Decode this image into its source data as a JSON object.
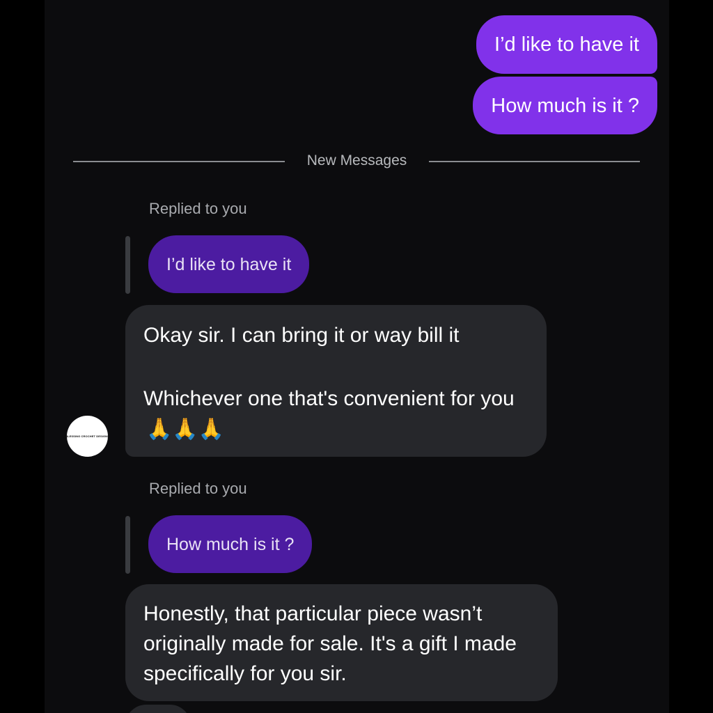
{
  "conversation": {
    "outgoing": [
      {
        "text": "I’d like to have it"
      },
      {
        "text": "How much is it ?"
      }
    ],
    "divider_label": "New Messages",
    "replies": [
      {
        "replied_label": "Replied to you",
        "quoted_text": "I’d like to have it",
        "reply_paragraph_1": "Okay sir. I can bring it or way bill it",
        "reply_paragraph_2": "Whichever one that's convenient for you",
        "reply_emoji": "🙏🙏🙏"
      },
      {
        "replied_label": "Replied to you",
        "quoted_text": "How much is it ?",
        "reply_text": "Honestly, that particular piece wasn’t originally made for sale. It's a gift I made specifically for you sir."
      }
    ],
    "sender_avatar_text": "BLESSING CROCHET DESIGNS"
  },
  "colors": {
    "outgoing_bubble": "#8132ea",
    "quoted_bubble": "#4c1ca1",
    "incoming_bubble": "#26272b",
    "background": "#0c0c0e"
  },
  "icons": {
    "reply_emoji": "folded-hands-icon"
  }
}
